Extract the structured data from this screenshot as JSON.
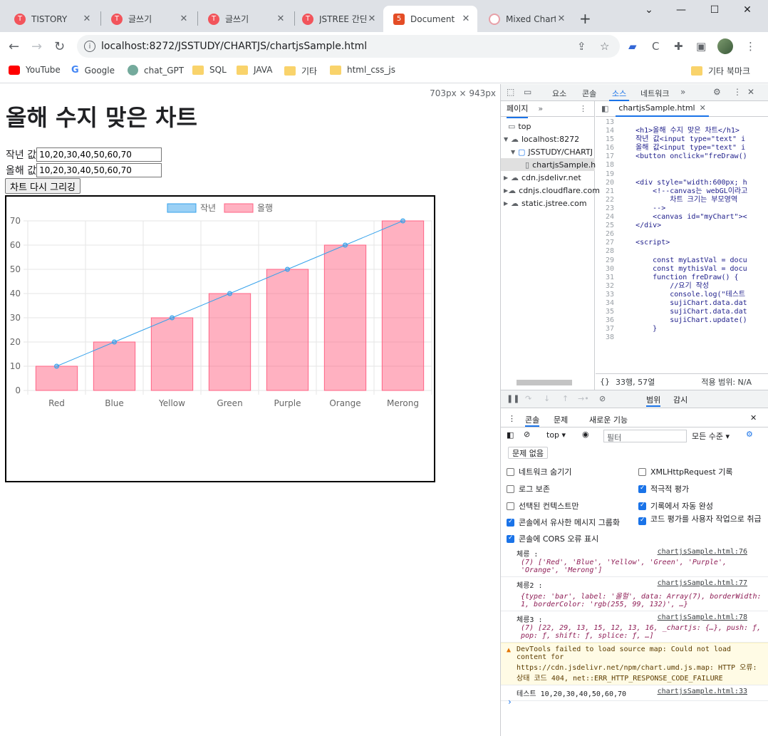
{
  "browser": {
    "tabs": [
      {
        "title": "TISTORY"
      },
      {
        "title": "글쓰기"
      },
      {
        "title": "글쓰기"
      },
      {
        "title": "JSTREE 간단"
      },
      {
        "title": "Document"
      },
      {
        "title": "Mixed Chart"
      }
    ],
    "url": "localhost:8272/JSSTUDY/CHARTJS/chartjsSample.html",
    "bookmarks": [
      "YouTube",
      "Google",
      "chat_GPT",
      "SQL",
      "JAVA",
      "기타",
      "html_css_js"
    ],
    "bookmarks_right": "기타 북마크"
  },
  "page": {
    "size_label": "703px × 943px",
    "title": "올해 수지 맞은 차트",
    "last_label": "작년 값",
    "last_value": "10,20,30,40,50,60,70",
    "this_label": "올해 값",
    "this_value": "10,20,30,40,50,60,70",
    "redraw_button": "차트 다시 그리깅"
  },
  "chart_data": {
    "type": "bar",
    "categories": [
      "Red",
      "Blue",
      "Yellow",
      "Green",
      "Purple",
      "Orange",
      "Merong"
    ],
    "series": [
      {
        "name": "작년",
        "type": "line",
        "values": [
          10,
          20,
          30,
          40,
          50,
          60,
          70
        ],
        "color": "#36a2eb"
      },
      {
        "name": "올행",
        "type": "bar",
        "values": [
          10,
          20,
          30,
          40,
          50,
          60,
          70
        ],
        "color": "#ff6384"
      }
    ],
    "yticks": [
      0,
      10,
      20,
      30,
      40,
      50,
      60,
      70
    ],
    "ylim": [
      0,
      70
    ],
    "legend": "top-center",
    "grid": true
  },
  "devtools": {
    "top_tabs": [
      "요소",
      "콘솔",
      "소스",
      "네트워크"
    ],
    "active_top_tab": "소스",
    "nav_tab": "페이지",
    "tree": [
      {
        "label": "top",
        "depth": 0
      },
      {
        "label": "localhost:8272",
        "depth": 1
      },
      {
        "label": "JSSTUDY/CHARTJ",
        "depth": 2
      },
      {
        "label": "chartjsSample.h",
        "depth": 3
      },
      {
        "label": "cdn.jsdelivr.net",
        "depth": 1
      },
      {
        "label": "cdnjs.cloudflare.com",
        "depth": 1
      },
      {
        "label": "static.jstree.com",
        "depth": 1
      }
    ],
    "open_file": "chartjsSample.html",
    "code_lines": [
      {
        "no": "13",
        "text": ""
      },
      {
        "no": "14",
        "text": "    <h1>올해 수지 맞은 차트</h1>"
      },
      {
        "no": "15",
        "text": "    작년 값<input type=\"text\" i"
      },
      {
        "no": "16",
        "text": "    올해 값<input type=\"text\" i"
      },
      {
        "no": "17",
        "text": "    <button onclick=\"freDraw()"
      },
      {
        "no": "18",
        "text": ""
      },
      {
        "no": "19",
        "text": ""
      },
      {
        "no": "20",
        "text": "    <div style=\"width:600px; h"
      },
      {
        "no": "21",
        "text": "        <!--canvas는 webGL이라고"
      },
      {
        "no": "22",
        "text": "            차트 크기는 부모영역"
      },
      {
        "no": "23",
        "text": "        -->"
      },
      {
        "no": "24",
        "text": "        <canvas id=\"myChart\"><"
      },
      {
        "no": "25",
        "text": "    </div>"
      },
      {
        "no": "26",
        "text": ""
      },
      {
        "no": "27",
        "text": "    <script>"
      },
      {
        "no": "28",
        "text": ""
      },
      {
        "no": "29",
        "text": "        const myLastVal = docu"
      },
      {
        "no": "30",
        "text": "        const mythisVal = docu"
      },
      {
        "no": "31",
        "text": "        function freDraw() {"
      },
      {
        "no": "32",
        "text": "            //요기 작성"
      },
      {
        "no": "33",
        "text": "            console.log(\"테스트"
      },
      {
        "no": "34",
        "text": "            sujiChart.data.dat"
      },
      {
        "no": "35",
        "text": "            sujiChart.data.dat"
      },
      {
        "no": "36",
        "text": "            sujiChart.update()"
      },
      {
        "no": "37",
        "text": "        }"
      },
      {
        "no": "38",
        "text": ""
      }
    ],
    "cursor_pos": "33행, 57열",
    "coverage": "적용 범위: N/A",
    "debug_tabs": [
      "범위",
      "감시"
    ],
    "drawer_tabs": [
      "콘솔",
      "문제",
      "새로운 기능"
    ],
    "context": "top",
    "filter_placeholder": "필터",
    "levels": "모든 수준",
    "issues_button": "문제 없음",
    "options_left": [
      {
        "label": "네트워크 숨기기",
        "checked": false
      },
      {
        "label": "로그 보존",
        "checked": false
      },
      {
        "label": "선택된 컨텍스트만",
        "checked": false
      },
      {
        "label": "콘솔에서 유사한 메시지 그룹화",
        "checked": true
      },
      {
        "label": "콘솔에 CORS 오류 표시",
        "checked": true
      }
    ],
    "options_right": [
      {
        "label": "XMLHttpRequest 기록",
        "checked": false
      },
      {
        "label": "적극적 평가",
        "checked": true
      },
      {
        "label": "기록에서 자동 완성",
        "checked": true
      },
      {
        "label": "코드 평가를 사용자 작업으로 취급",
        "checked": true
      }
    ]
  },
  "console": {
    "messages": [
      {
        "head": "체릉 :",
        "src": "chartjsSample.html:76",
        "body": "(7) ['Red', 'Blue', 'Yellow', 'Green', 'Purple', 'Orange', 'Merong']"
      },
      {
        "head": "체릉2 :",
        "src": "chartjsSample.html:77",
        "body": "{type: 'bar', label: '올헐', data: Array(7), borderWidth: 1, borderColor: 'rgb(255, 99, 132)', …}"
      },
      {
        "head": "체릉3 :",
        "src": "chartjsSample.html:78",
        "body": "(7) [22, 29, 13, 15, 12, 13, 16, _chartjs: {…}, push: ƒ, pop: ƒ, shift: ƒ, splice: ƒ, …]"
      }
    ],
    "warning": "DevTools failed to load source map: Could not load content for https://cdn.jsdelivr.net/npm/chart.umd.js.map: HTTP 오류: 상태 코드 404, net::ERR_HTTP_RESPONSE_CODE_FAILURE",
    "log_text": "테스트 10,20,30,40,50,60,70",
    "log_src": "chartjsSample.html:33"
  }
}
